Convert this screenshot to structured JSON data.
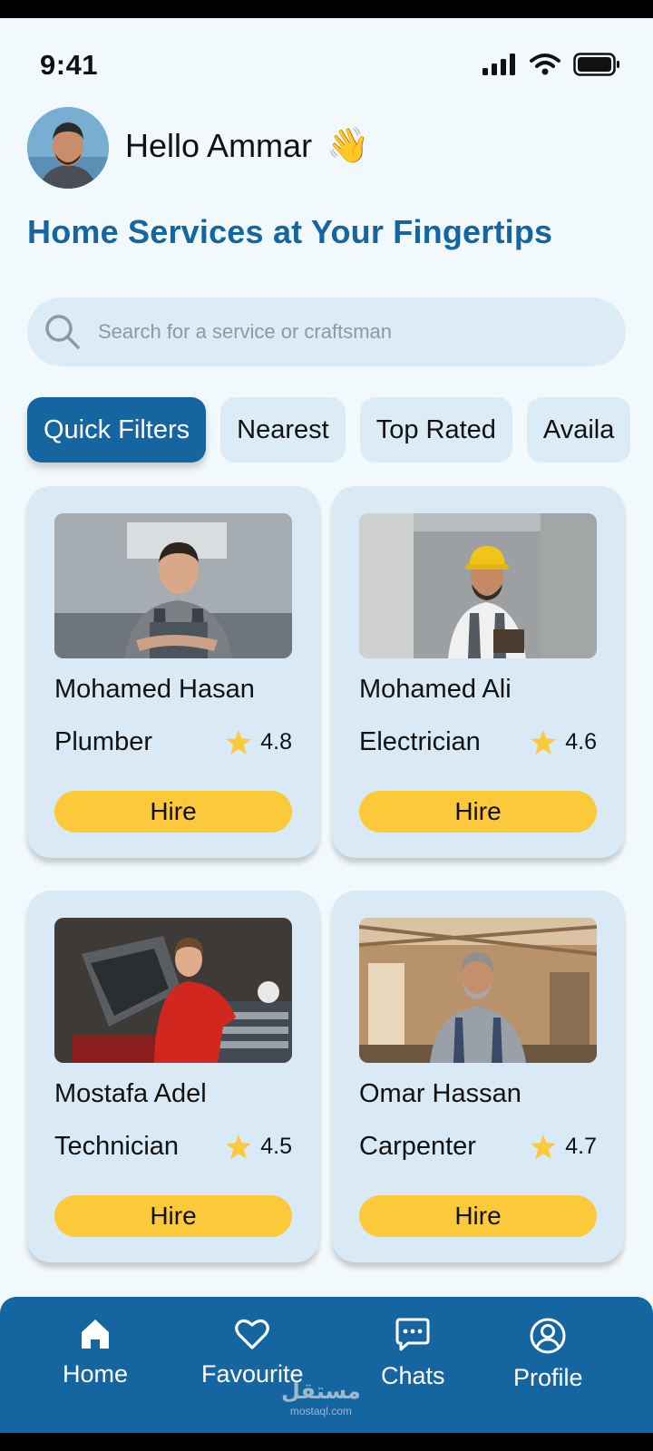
{
  "status": {
    "time": "9:41"
  },
  "header": {
    "greeting": "Hello Ammar",
    "emoji": "👋",
    "title": "Home Services at Your Fingertips"
  },
  "search": {
    "placeholder": "Search for a service or craftsman"
  },
  "filters": [
    {
      "label": "Quick Filters",
      "active": true
    },
    {
      "label": "Nearest"
    },
    {
      "label": "Top Rated"
    },
    {
      "label": "Availa"
    }
  ],
  "cards": [
    {
      "name": "Mohamed Hasan",
      "role": "Plumber",
      "rating": "4.8",
      "hire": "Hire"
    },
    {
      "name": "Mohamed Ali",
      "role": "Electrician",
      "rating": "4.6",
      "hire": "Hire"
    },
    {
      "name": "Mostafa Adel",
      "role": "Technician",
      "rating": "4.5",
      "hire": "Hire"
    },
    {
      "name": "Omar Hassan",
      "role": "Carpenter",
      "rating": "4.7",
      "hire": "Hire"
    }
  ],
  "nav": [
    {
      "label": "Home",
      "icon": "home-icon"
    },
    {
      "label": "Favourite",
      "icon": "heart-icon"
    },
    {
      "label": "Chats",
      "icon": "chat-icon"
    },
    {
      "label": "Profile",
      "icon": "profile-icon"
    }
  ],
  "watermark": {
    "arabic": "مستقل",
    "latin": "mostaql.com"
  },
  "colors": {
    "primary": "#1565a0",
    "accent": "#fcc93a",
    "card_bg": "#d9eaf6",
    "page_bg": "#f2f9fd"
  }
}
